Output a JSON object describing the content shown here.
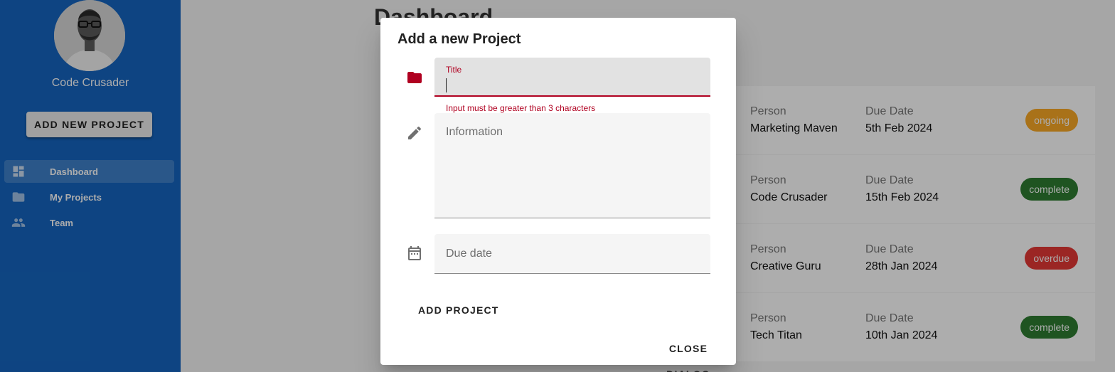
{
  "sidebar": {
    "user_name": "Code Crusader",
    "add_button_label": "ADD NEW PROJECT",
    "items": [
      {
        "label": "Dashboard",
        "icon": "dashboard-icon",
        "active": true
      },
      {
        "label": "My Projects",
        "icon": "folder-icon",
        "active": false
      },
      {
        "label": "Team",
        "icon": "people-icon",
        "active": false
      }
    ]
  },
  "main": {
    "title": "Dashboard",
    "projects": [
      {
        "person_label": "Person",
        "person": "Marketing Maven",
        "due_label": "Due Date",
        "due": "5th Feb 2024",
        "status": "ongoing"
      },
      {
        "person_label": "Person",
        "person": "Code Crusader",
        "due_label": "Due Date",
        "due": "15th Feb 2024",
        "status": "complete"
      },
      {
        "person_label": "Person",
        "person": "Creative Guru",
        "due_label": "Due Date",
        "due": "28th Jan 2024",
        "status": "overdue"
      },
      {
        "person_label": "Person",
        "person": "Tech Titan",
        "due_label": "Due Date",
        "due": "10th Jan 2024",
        "status": "complete"
      }
    ]
  },
  "dialog": {
    "title": "Add a new Project",
    "title_field": {
      "label": "Title",
      "value": "",
      "error": "Input must be greater than 3 characters"
    },
    "info_field": {
      "placeholder": "Information"
    },
    "date_field": {
      "placeholder": "Due date"
    },
    "add_label": "ADD PROJECT",
    "close_label": "CLOSE DIALOG"
  },
  "colors": {
    "sidebar": "#1565c0",
    "error": "#b00020",
    "ongoing": "#f9a825",
    "complete": "#2e7d32",
    "overdue": "#e53935"
  }
}
